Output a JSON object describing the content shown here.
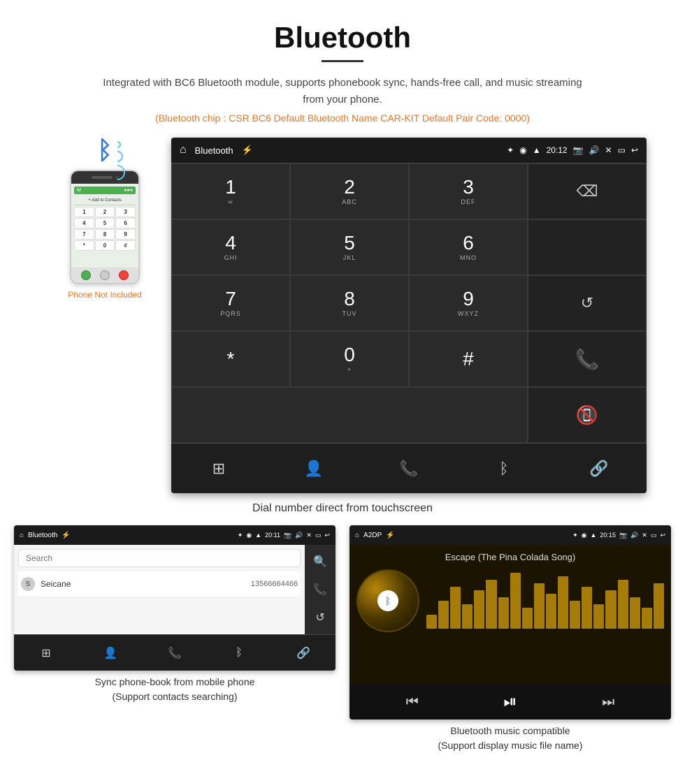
{
  "header": {
    "title": "Bluetooth",
    "description": "Integrated with BC6 Bluetooth module, supports phonebook sync, hands-free call, and music streaming from your phone.",
    "specs": "(Bluetooth chip : CSR BC6    Default Bluetooth Name CAR-KIT    Default Pair Code: 0000)"
  },
  "main_screen": {
    "statusbar": {
      "app_name": "Bluetooth",
      "time": "20:12"
    },
    "dialpad": {
      "keys": [
        {
          "digit": "1",
          "sub": "∞",
          "col": 1
        },
        {
          "digit": "2",
          "sub": "ABC",
          "col": 2
        },
        {
          "digit": "3",
          "sub": "DEF",
          "col": 3
        },
        {
          "digit": "",
          "sub": "",
          "col": 4
        },
        {
          "digit": "4",
          "sub": "GHI",
          "col": 1
        },
        {
          "digit": "5",
          "sub": "JKL",
          "col": 2
        },
        {
          "digit": "6",
          "sub": "MNO",
          "col": 3
        },
        {
          "digit": "",
          "sub": "",
          "col": 4
        },
        {
          "digit": "7",
          "sub": "PQRS",
          "col": 1
        },
        {
          "digit": "8",
          "sub": "TUV",
          "col": 2
        },
        {
          "digit": "9",
          "sub": "WXYZ",
          "col": 3
        },
        {
          "digit": "",
          "sub": "",
          "col": 4
        },
        {
          "digit": "*",
          "sub": "",
          "col": 1
        },
        {
          "digit": "0",
          "sub": "+",
          "col": 2
        },
        {
          "digit": "#",
          "sub": "",
          "col": 3
        },
        {
          "digit": "",
          "sub": "",
          "col": 4
        }
      ]
    },
    "caption": "Dial number direct from touchscreen"
  },
  "phone_illustration": {
    "not_included_text": "Phone Not Included",
    "keypad_keys": [
      "1",
      "2",
      "3",
      "4",
      "5",
      "6",
      "7",
      "8",
      "9",
      "*",
      "0",
      "#"
    ]
  },
  "phonebook_screen": {
    "statusbar": {
      "app_name": "Bluetooth",
      "time": "20:11"
    },
    "search_placeholder": "Search",
    "contacts": [
      {
        "letter": "S",
        "name": "Seicane",
        "number": "13566664466"
      }
    ],
    "caption_line1": "Sync phone-book from mobile phone",
    "caption_line2": "(Support contacts searching)"
  },
  "music_screen": {
    "statusbar": {
      "app_name": "A2DP",
      "time": "20:15"
    },
    "song_title": "Escape (The Pina Colada Song)",
    "waveform_bars": [
      20,
      40,
      60,
      35,
      55,
      70,
      45,
      80,
      30,
      65,
      50,
      75,
      40,
      60,
      35,
      55,
      70,
      45,
      30,
      65
    ],
    "caption_line1": "Bluetooth music compatible",
    "caption_line2": "(Support display music file name)"
  },
  "icons": {
    "home": "⌂",
    "bluetooth": "✦",
    "usb": "⚡",
    "location": "◉",
    "wifi": "▲",
    "camera": "📷",
    "volume": "🔊",
    "close_sq": "✕",
    "window": "▭",
    "back": "↩",
    "backspace": "⌫",
    "refresh": "↺",
    "call_green": "📞",
    "call_red": "📵",
    "grid": "⊞",
    "person": "👤",
    "phone": "📞",
    "bt": "ᛒ",
    "link": "🔗",
    "search": "🔍",
    "prev": "⏮",
    "play_pause": "⏯",
    "next": "⏭"
  }
}
